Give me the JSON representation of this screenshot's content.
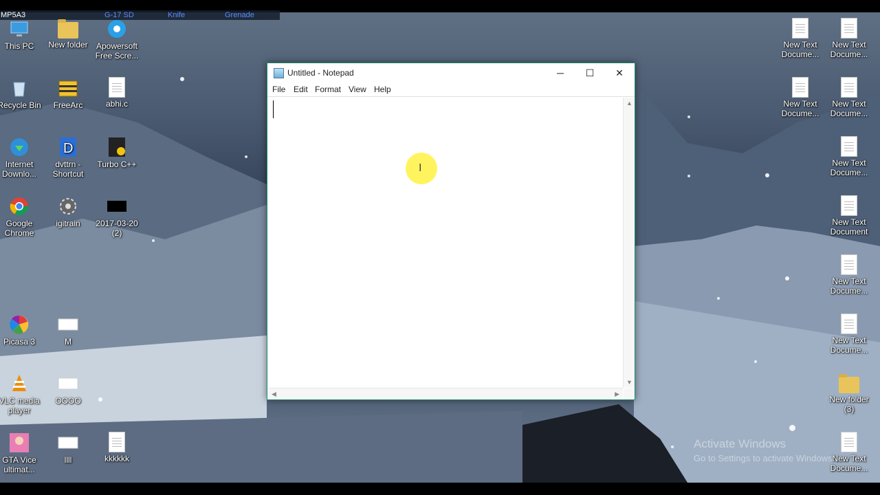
{
  "hud": {
    "weapons": [
      "MP5A3",
      "G-17 SD",
      "Knife",
      "Grenade"
    ]
  },
  "desktop": {
    "left_icons": [
      {
        "label": "This PC",
        "icon": "this-pc-icon"
      },
      {
        "label": "New folder",
        "icon": "folder-icon"
      },
      {
        "label": "Apowersoft Free Scre...",
        "icon": "apowersoft-icon"
      },
      {
        "label": "Recycle Bin",
        "icon": "recycle-bin-icon"
      },
      {
        "label": "FreeArc",
        "icon": "freearc-icon"
      },
      {
        "label": "abhi.c",
        "icon": "document-icon"
      },
      {
        "label": "Internet Downlo...",
        "icon": "idm-icon"
      },
      {
        "label": "dvttrn - Shortcut",
        "icon": "dvttrn-icon"
      },
      {
        "label": "Turbo C++",
        "icon": "turbo-cpp-icon"
      },
      {
        "label": "Google Chrome",
        "icon": "chrome-icon"
      },
      {
        "label": "igitrain",
        "icon": "gear-icon"
      },
      {
        "label": "2017-03-20 (2)",
        "icon": "video-thumbnail-icon"
      },
      {
        "label": "Picasa 3",
        "icon": "picasa-icon"
      },
      {
        "label": "M",
        "icon": "document-icon"
      },
      {
        "label": "VLC media player",
        "icon": "vlc-icon"
      },
      {
        "label": "OOOO",
        "icon": "document-icon"
      },
      {
        "label": "GTA Vice ultimat...",
        "icon": "gta-icon"
      },
      {
        "label": "llll",
        "icon": "document-icon"
      },
      {
        "label": "kkkkkk",
        "icon": "document-icon"
      }
    ],
    "right_icons": [
      {
        "label": "New Text Docume..."
      },
      {
        "label": "New Text Docume..."
      },
      {
        "label": "New Text Docume..."
      },
      {
        "label": "New Text Docume..."
      },
      {
        "label": "New Text Docume..."
      },
      {
        "label": "New Text Document"
      },
      {
        "label": "New Text Docume..."
      },
      {
        "label": "New Text Docume..."
      },
      {
        "label": "New folder (3)"
      },
      {
        "label": "New Text Docume..."
      }
    ]
  },
  "notepad": {
    "title": "Untitled - Notepad",
    "menu": [
      "File",
      "Edit",
      "Format",
      "View",
      "Help"
    ],
    "controls": {
      "minimize": "─",
      "maximize": "☐",
      "close": "✕"
    },
    "content": ""
  },
  "watermark": {
    "line1": "Activate Windows",
    "line2": "Go to Settings to activate Windows."
  },
  "colors": {
    "window_border": "#1e8f6e",
    "cursor_highlight": "#ffef28"
  }
}
